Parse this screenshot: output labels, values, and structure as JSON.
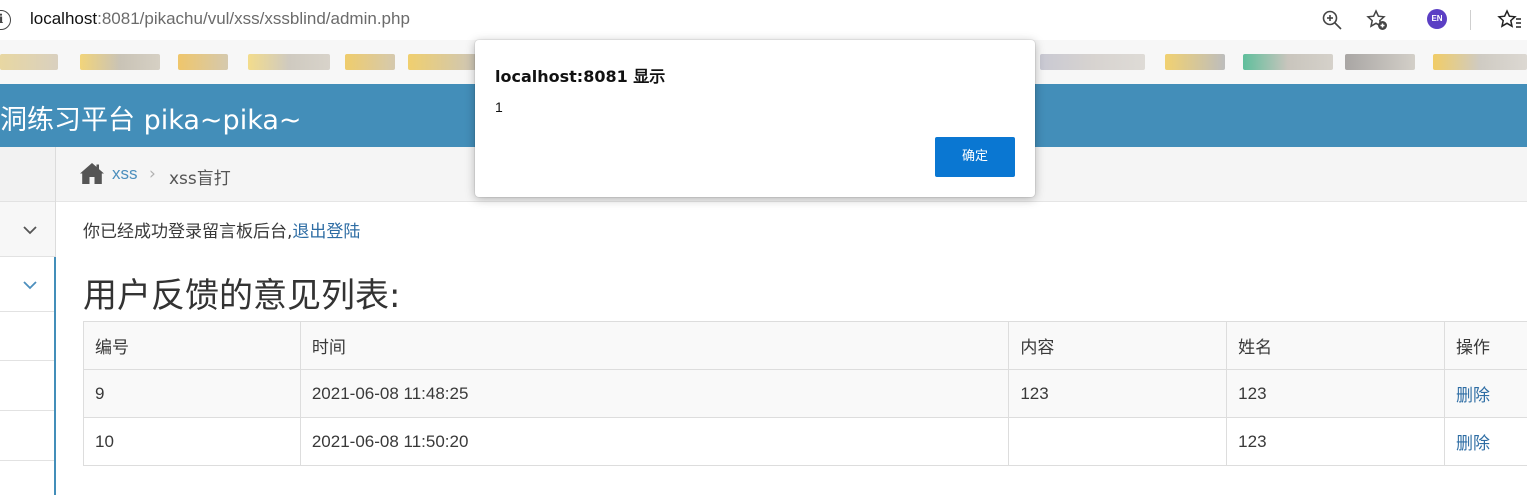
{
  "browser": {
    "url_host": "localhost",
    "url_rest": ":8081/pikachu/vul/xss/xssblind/admin.php",
    "profile_badge": "EN",
    "icons": [
      "info-icon",
      "zoom-icon",
      "favorite-add-icon",
      "favorites-icon"
    ]
  },
  "site": {
    "title": "洞练习平台 pika~pika~",
    "accent_color": "#438eb9"
  },
  "breadcrumb": {
    "link": "xss",
    "separator": "›",
    "current": "xss盲打"
  },
  "main": {
    "login_message": "你已经成功登录留言板后台,",
    "logout_link": "退出登陆",
    "heading": "用户反馈的意见列表:",
    "table": {
      "headers": [
        "编号",
        "时间",
        "内容",
        "姓名",
        "操作"
      ],
      "rows": [
        {
          "id": "9",
          "time": "2021-06-08 11:48:25",
          "content": "123",
          "name": "123",
          "action": "删除"
        },
        {
          "id": "10",
          "time": "2021-06-08 11:50:20",
          "content": "",
          "name": "123",
          "action": "删除"
        }
      ]
    }
  },
  "dialog": {
    "title": "localhost:8081 显示",
    "message": "1",
    "ok_label": "确定"
  }
}
